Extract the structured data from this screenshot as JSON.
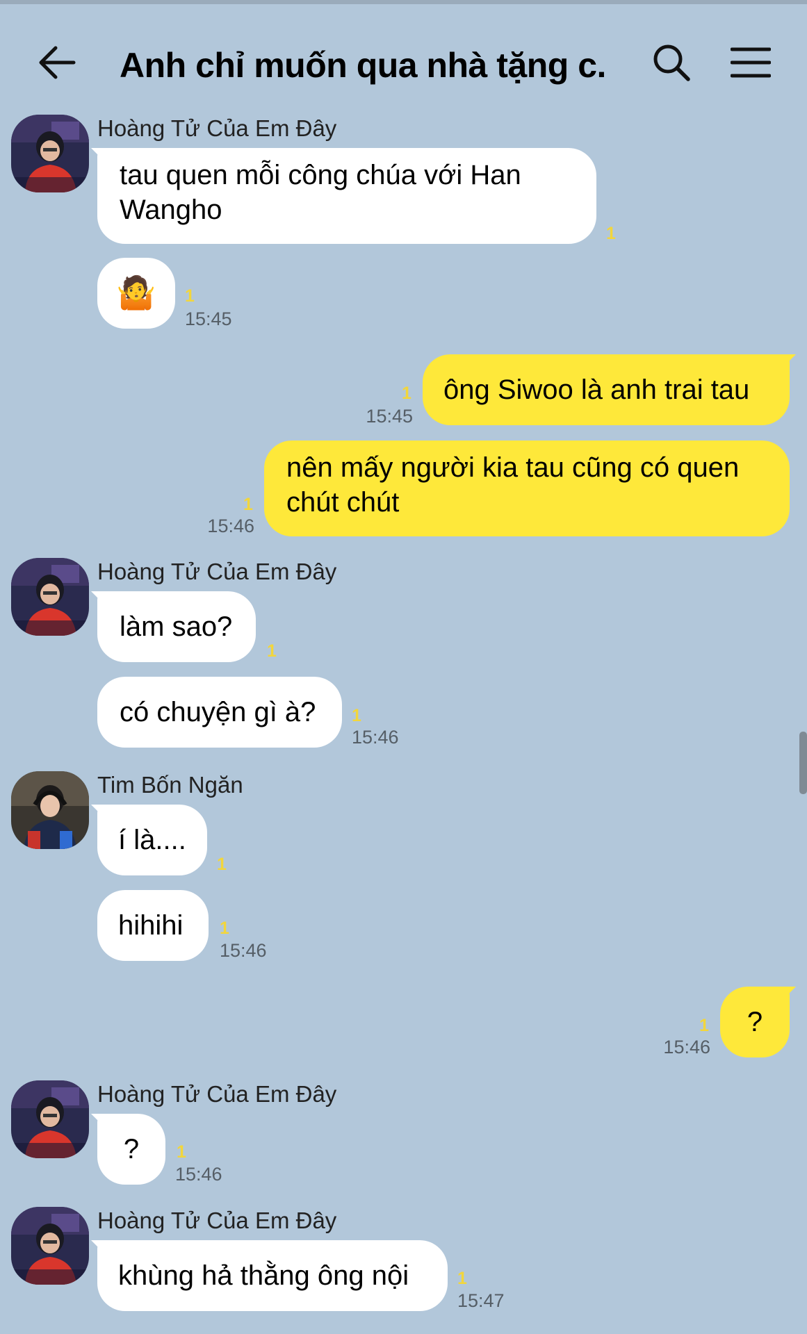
{
  "header": {
    "title": "Anh chỉ muốn qua nhà tặng c...",
    "back_icon": "arrow-left-icon",
    "search_icon": "search-icon",
    "menu_icon": "hamburger-menu-icon"
  },
  "colors": {
    "background": "#b2c7da",
    "incoming_bubble": "#ffffff",
    "outgoing_bubble": "#fee83a",
    "unread_count": "#f2d63c"
  },
  "messages": [
    {
      "sender": "Hoàng Tử Của Em Đây",
      "avatar": "avatar-gamer-red-jersey",
      "direction": "in",
      "items": [
        {
          "text": "tau quen mỗi công chúa với Han\nWangho",
          "unread": "1"
        },
        {
          "text": "🤷",
          "unread": "1",
          "time": "15:45"
        }
      ]
    },
    {
      "direction": "out",
      "items": [
        {
          "text": "ông Siwoo là anh trai tau",
          "unread": "1",
          "time": "15:45"
        },
        {
          "text": "nên mấy người kia tau cũng có quen\nchút chút",
          "unread": "1",
          "time": "15:46"
        }
      ]
    },
    {
      "sender": "Hoàng Tử Của Em Đây",
      "avatar": "avatar-gamer-red-jersey",
      "direction": "in",
      "items": [
        {
          "text": "làm sao?",
          "unread": "1"
        },
        {
          "text": "có chuyện gì à?",
          "unread": "1",
          "time": "15:46"
        }
      ]
    },
    {
      "sender": "Tim Bốn Ngăn",
      "avatar": "avatar-person-headphones",
      "direction": "in",
      "items": [
        {
          "text": "í là....",
          "unread": "1"
        },
        {
          "text": "hihihi",
          "unread": "1",
          "time": "15:46"
        }
      ]
    },
    {
      "direction": "out",
      "items": [
        {
          "text": "?",
          "unread": "1",
          "time": "15:46"
        }
      ]
    },
    {
      "sender": "Hoàng Tử Của Em Đây",
      "avatar": "avatar-gamer-red-jersey",
      "direction": "in",
      "items": [
        {
          "text": "?",
          "unread": "1",
          "time": "15:46"
        }
      ]
    },
    {
      "sender": "Hoàng Tử Của Em Đây",
      "avatar": "avatar-gamer-red-jersey",
      "direction": "in",
      "items": [
        {
          "text": "khùng hả thằng ông nội",
          "unread": "1",
          "time": "15:47"
        }
      ]
    }
  ]
}
